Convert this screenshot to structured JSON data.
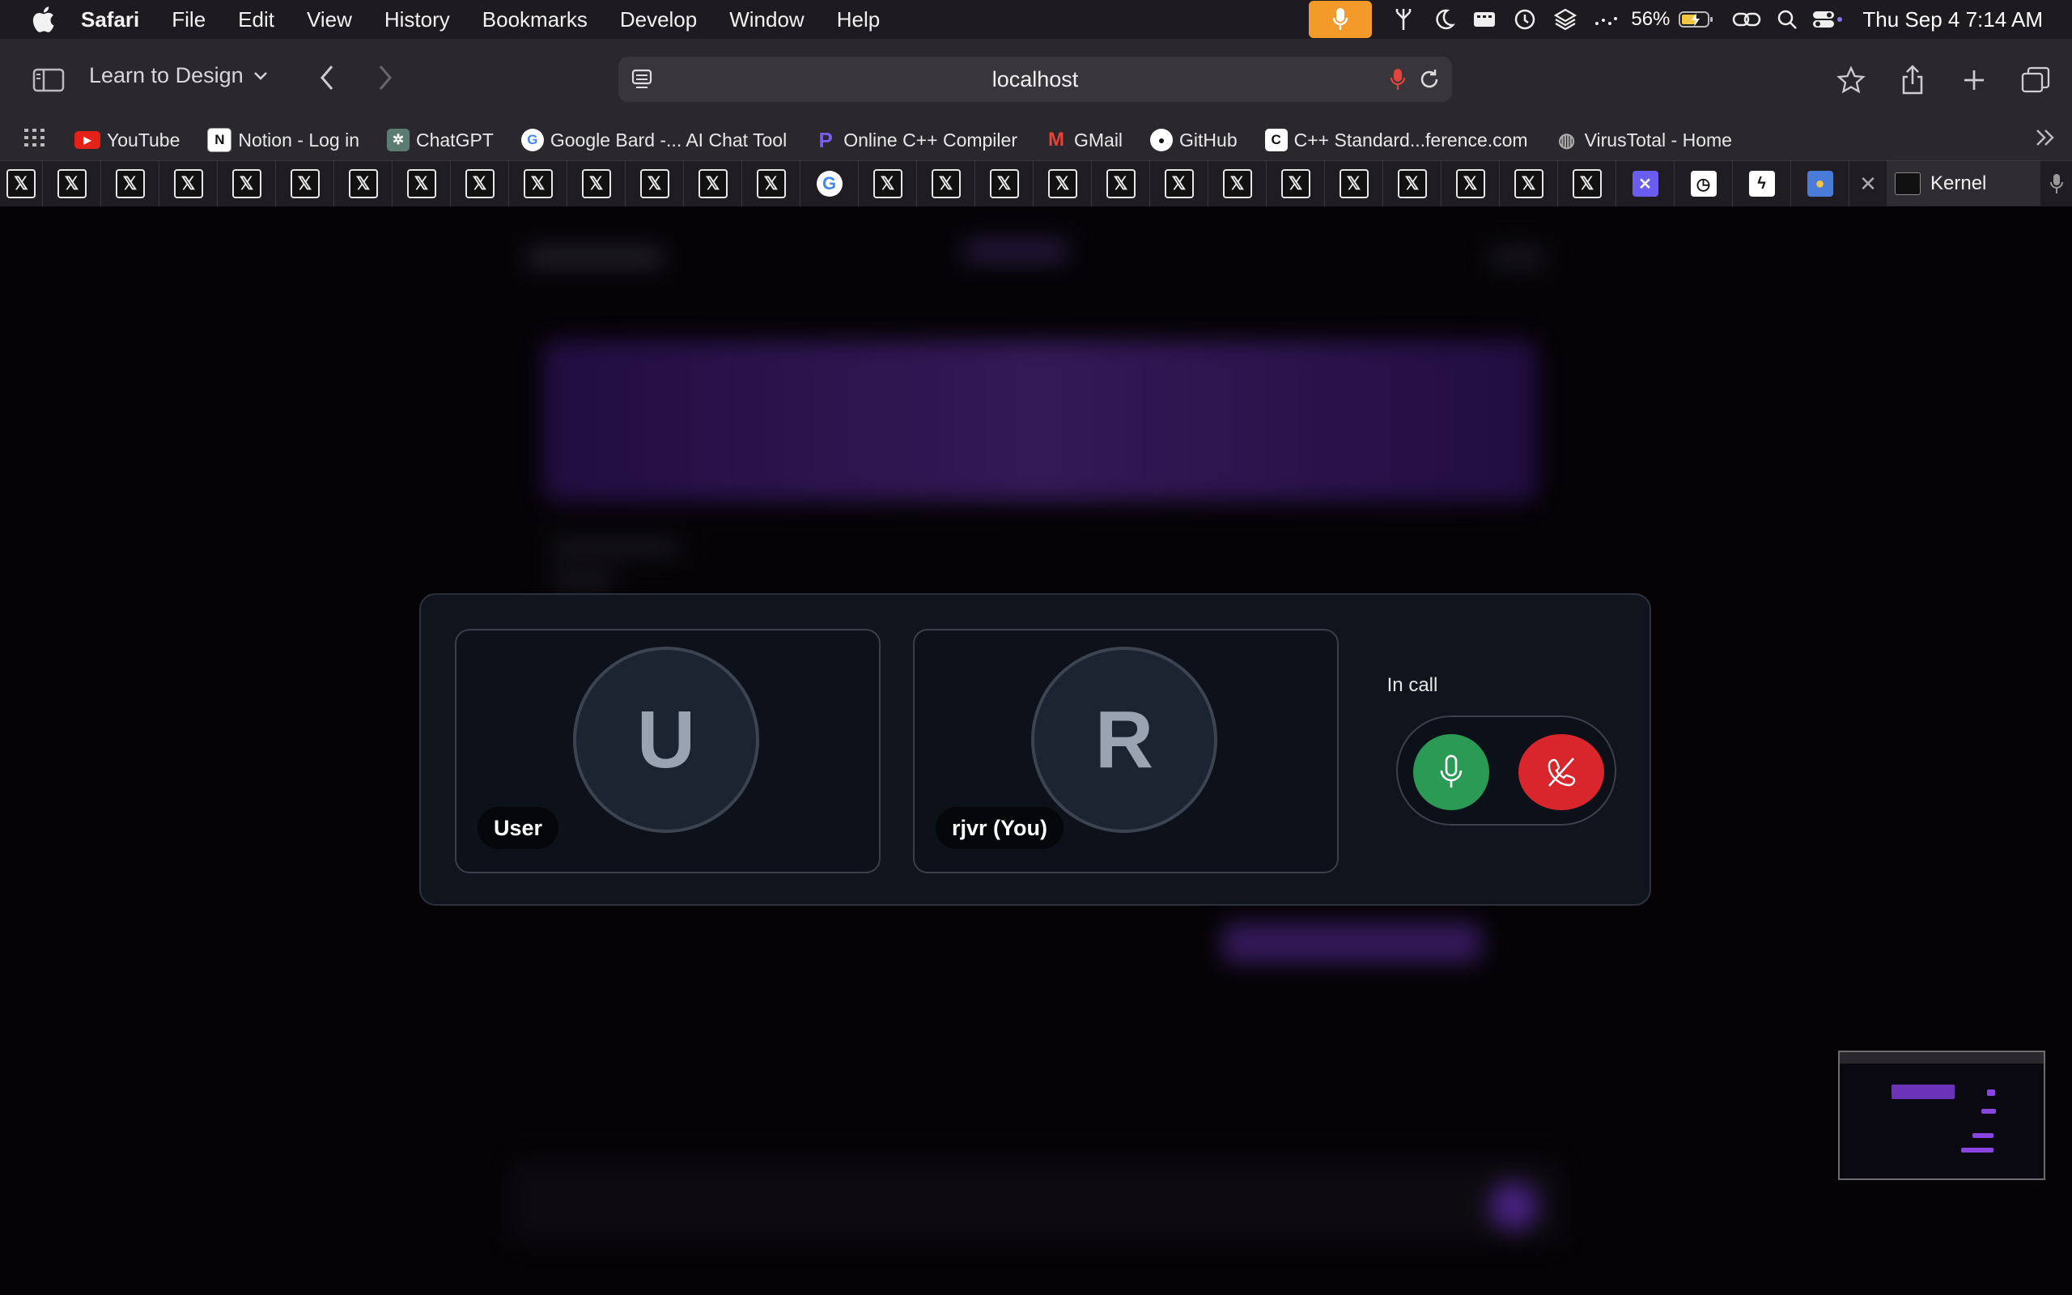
{
  "menubar": {
    "app_name": "Safari",
    "menus": [
      "File",
      "Edit",
      "View",
      "History",
      "Bookmarks",
      "Develop",
      "Window",
      "Help"
    ],
    "battery": "56%",
    "clock": "Thu Sep 4  7:14 AM",
    "accent_mic": "#f49a2a"
  },
  "toolbar": {
    "tab_group": "Learn to Design",
    "url": "localhost"
  },
  "bookmarks": [
    {
      "label": "YouTube",
      "icon": "youtube-icon",
      "color": "#e62117",
      "glyph": "▶"
    },
    {
      "label": "Notion - Log in",
      "icon": "notion-icon",
      "color": "#ffffff",
      "glyph": "N"
    },
    {
      "label": "ChatGPT",
      "icon": "chatgpt-icon",
      "color": "#5c7c72",
      "glyph": "✲"
    },
    {
      "label": "Google Bard -... AI Chat Tool",
      "icon": "google-icon",
      "color": "#ffffff",
      "glyph": "G"
    },
    {
      "label": "Online C++ Compiler",
      "icon": "compiler-icon",
      "color": "#6d4ee8",
      "glyph": "P"
    },
    {
      "label": "GMail",
      "icon": "gmail-icon",
      "color": "#ffffff",
      "glyph": "M"
    },
    {
      "label": "GitHub",
      "icon": "github-icon",
      "color": "#ffffff",
      "glyph": "●"
    },
    {
      "label": "C++ Standard...ference.com",
      "icon": "cppreference-icon",
      "color": "#ffffff",
      "glyph": "C"
    },
    {
      "label": "VirusTotal - Home",
      "icon": "globe-icon",
      "color": "#9a9a9a",
      "glyph": "◍"
    }
  ],
  "tabs": {
    "active_label": "Kernel"
  },
  "call": {
    "status": "In call",
    "participants": [
      {
        "initial": "U",
        "name": "User"
      },
      {
        "initial": "R",
        "name": "rjvr (You)"
      }
    ],
    "mic_color": "#2b9a55",
    "end_color": "#d9262c"
  }
}
